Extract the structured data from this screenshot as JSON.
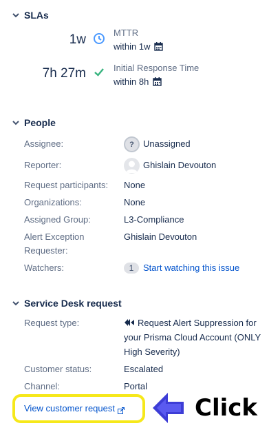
{
  "slas": {
    "title": "SLAs",
    "items": [
      {
        "time": "1w",
        "name": "MTTR",
        "target": "within 1w",
        "status_icon": "clock-icon",
        "color": "#4c9aff"
      },
      {
        "time": "7h 27m",
        "name": "Initial Response Time",
        "target": "within 8h",
        "status_icon": "check-icon",
        "color": "#36b37e"
      }
    ]
  },
  "people": {
    "title": "People",
    "assignee_label": "Assignee:",
    "assignee_value": "Unassigned",
    "reporter_label": "Reporter:",
    "reporter_value": "Ghislain Devouton",
    "participants_label": "Request participants:",
    "participants_value": "None",
    "organizations_label": "Organizations:",
    "organizations_value": "None",
    "assigned_group_label": "Assigned Group:",
    "assigned_group_value": "L3-Compliance",
    "alert_requester_label_1": "Alert Exception",
    "alert_requester_label_2": "Requester:",
    "alert_requester_value": "Ghislain Devouton",
    "watchers_label": "Watchers:",
    "watchers_count": "1",
    "watch_link": "Start watching this issue"
  },
  "service_desk": {
    "title": "Service Desk request",
    "request_type_label": "Request type:",
    "request_type_value": "Request Alert Suppression for your Prisma Cloud Account (ONLY High Severity)",
    "customer_status_label": "Customer status:",
    "customer_status_value": "Escalated",
    "channel_label": "Channel:",
    "channel_value": "Portal",
    "view_link": "View customer request"
  },
  "annotation": {
    "click_text": "Click",
    "highlight_color": "#f6e81a",
    "arrow_color": "#3d3dd6"
  }
}
